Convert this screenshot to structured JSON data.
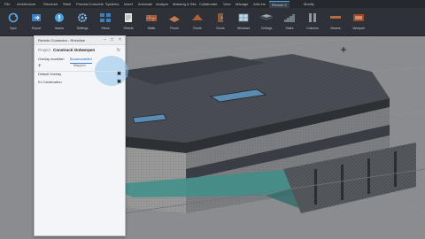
{
  "ribbon": {
    "tabs": [
      "File",
      "Architecture",
      "Structure",
      "Steel",
      "Precast Concrete",
      "Systems",
      "Insert",
      "Annotate",
      "Analyze",
      "Massing & Site",
      "Collaborate",
      "View",
      "Manage",
      "Add-Ins",
      "Revizto 5",
      "Modify"
    ],
    "active_tab_index": 14,
    "tools": [
      {
        "label": "Sync",
        "icon": "sync-icon"
      },
      {
        "label": "Export",
        "icon": "export-icon"
      },
      {
        "label": "Issues",
        "icon": "issues-icon"
      },
      {
        "label": "Settings",
        "icon": "settings-icon"
      },
      {
        "label": "Views",
        "icon": "views-icon"
      },
      {
        "label": "Sheets",
        "icon": "sheets-icon"
      },
      {
        "label": "Walls",
        "icon": "walls-icon"
      },
      {
        "label": "Floors",
        "icon": "floors-icon"
      },
      {
        "label": "Roofs",
        "icon": "roofs-icon"
      },
      {
        "label": "Doors",
        "icon": "doors-icon"
      },
      {
        "label": "Windows",
        "icon": "windows-icon"
      },
      {
        "label": "Ceilings",
        "icon": "ceilings-icon"
      },
      {
        "label": "Stairs",
        "icon": "stairs-icon"
      },
      {
        "label": "Columns",
        "icon": "columns-icon"
      },
      {
        "label": "Beams",
        "icon": "beams-icon"
      },
      {
        "label": "Viewport",
        "icon": "viewport-icon"
      }
    ]
  },
  "panel": {
    "title": "Revizto Connector - Rhinolize",
    "project_label": "Project",
    "project_name": "Constructi Ontwerpen",
    "tabs": [
      "Overlay modellen",
      "Bouwmodellen"
    ],
    "active_tab_index": 1,
    "sub_info": "Mappen",
    "items": [
      {
        "label": "Default Overlay"
      },
      {
        "label": "01 Construction"
      }
    ]
  },
  "colors": {
    "accent": "#4ea2e0",
    "highlight": "#8cc3eb",
    "ribbon_bg": "#2e3238"
  }
}
